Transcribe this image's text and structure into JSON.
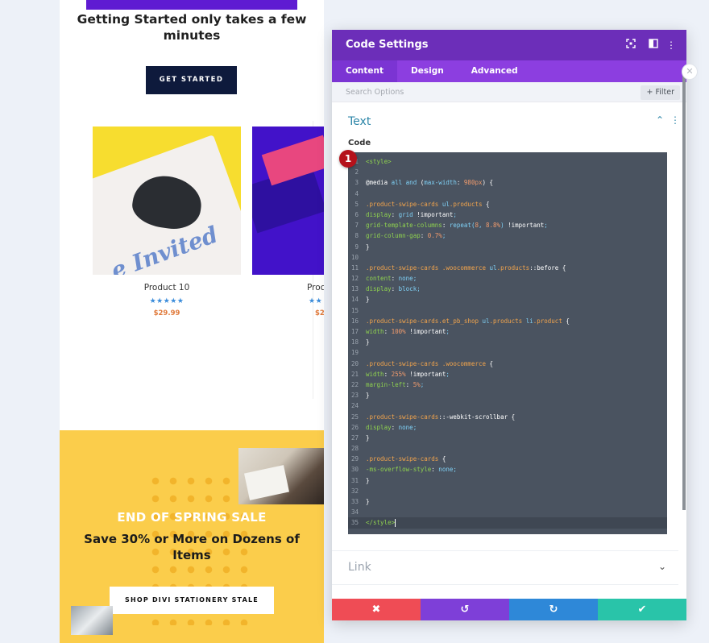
{
  "preview": {
    "hero_title": "Getting Started only takes a few minutes",
    "cta_label": "GET STARTED",
    "products": [
      {
        "name": "Product 10",
        "stars": "★★★★★",
        "price": "$29.99",
        "image_text": "e Invited"
      },
      {
        "name": "Proc",
        "stars": "★★",
        "price": "$2",
        "image_text": ""
      }
    ],
    "sale": {
      "eyebrow": "END OF SPRING SALE",
      "title": "Save 30% or More on Dozens of Items",
      "button_label": "SHOP DIVI STATIONERY STALE"
    }
  },
  "modal": {
    "title": "Code Settings",
    "header_icons": [
      "expand-icon",
      "split-view-icon",
      "more-vertical-icon"
    ],
    "tabs": [
      {
        "label": "Content",
        "active": true
      },
      {
        "label": "Design",
        "active": false
      },
      {
        "label": "Advanced",
        "active": false
      }
    ],
    "search_placeholder": "Search Options",
    "filter_label": "+ Filter",
    "section_title": "Text",
    "code_label": "Code",
    "badge": "1",
    "link_section": "Link",
    "code_lines": [
      "<style>",
      "",
      "@media all and (max-width: 980px) {",
      "",
      ".product-swipe-cards ul.products {",
      "display: grid !important;",
      "grid-template-columns: repeat(8, 8.8%) !important;",
      "grid-column-gap: 0.7%;",
      "}",
      "",
      ".product-swipe-cards .woocommerce ul.products::before {",
      "content: none;",
      "display: block;",
      "}",
      "",
      ".product-swipe-cards.et_pb_shop ul.products li.product {",
      "width: 100% !important;",
      "}",
      "",
      ".product-swipe-cards .woocommerce {",
      "width: 255% !important;",
      "margin-left: 5%;",
      "}",
      "",
      ".product-swipe-cards::-webkit-scrollbar {",
      "display: none;",
      "}",
      "",
      ".product-swipe-cards {",
      "-ms-overflow-style: none;",
      "}",
      "",
      "}",
      "",
      "</style>"
    ],
    "current_line": 35,
    "footer_icons": [
      "close-icon",
      "undo-icon",
      "redo-icon",
      "check-icon"
    ]
  },
  "colors": {
    "header": "#6c2eb9",
    "tabs": "#8c3ee0",
    "editor_bg": "#4a5360",
    "cancel": "#ef4c55",
    "undo": "#7e3fd8",
    "redo": "#2e88d8",
    "save": "#29c4a9",
    "badge": "#b5121b"
  }
}
